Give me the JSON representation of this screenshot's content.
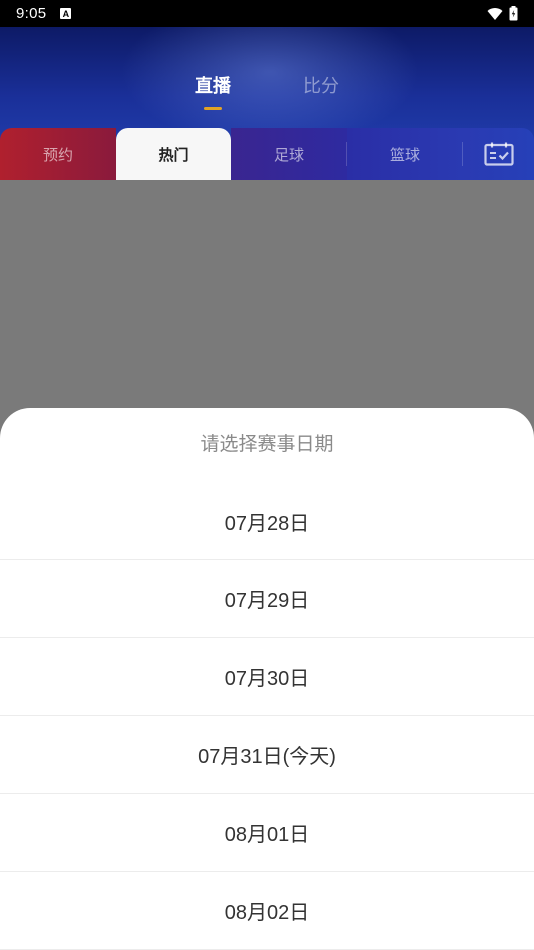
{
  "status_bar": {
    "time": "9:05",
    "notification_icon": "A"
  },
  "header": {
    "top_tabs": [
      {
        "label": "直播",
        "active": true
      },
      {
        "label": "比分",
        "active": false
      }
    ],
    "accent_color": "#e2a325",
    "sub_tabs": [
      {
        "label": "预约"
      },
      {
        "label": "热门",
        "active": true
      },
      {
        "label": "足球"
      },
      {
        "label": "篮球"
      }
    ],
    "calendar_icon": "calendar-check-icon"
  },
  "date_picker": {
    "title": "请选择赛事日期",
    "dates": [
      "07月28日",
      "07月29日",
      "07月30日",
      "07月31日(今天)",
      "08月01日",
      "08月02日"
    ]
  }
}
